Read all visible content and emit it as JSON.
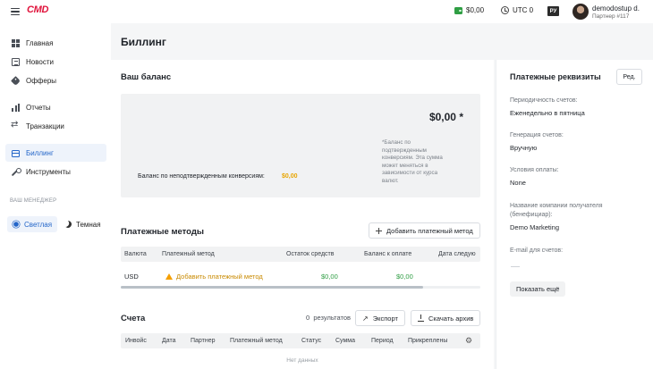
{
  "topbar": {
    "logo": "CMD",
    "balance": "$0,00",
    "timezone": "UTC 0",
    "language": "РУ",
    "user_name": "demodostup d.",
    "user_subtitle": "Партнер #117"
  },
  "sidebar": {
    "items": [
      {
        "label": "Главная",
        "icon": "dashboard-icon"
      },
      {
        "label": "Новости",
        "icon": "news-icon"
      },
      {
        "label": "Офферы",
        "icon": "tag-icon"
      },
      {
        "label": "Отчеты",
        "icon": "chart-icon"
      },
      {
        "label": "Транзакции",
        "icon": "transactions-icon"
      },
      {
        "label": "Биллинг",
        "icon": "credit-card-icon",
        "active": true
      },
      {
        "label": "Инструменты",
        "icon": "wrench-icon"
      }
    ],
    "manager_label": "ВАШ МЕНЕДЖЕР",
    "theme_light": "Светлая",
    "theme_dark": "Темная"
  },
  "page": {
    "title": "Биллинг"
  },
  "balance": {
    "heading": "Ваш баланс",
    "amount": "$0,00 *",
    "note": "*Баланс по подтвержденным конверсиям. Эта сумма может меняться в зависимости от курса валют.",
    "unconfirmed_label": "Баланс по неподтвержденным конверсиям:",
    "unconfirmed_value": "$0,00"
  },
  "payment_methods": {
    "heading": "Платежные методы",
    "add_button": "Добавить платежный метод",
    "columns": [
      "Валюта",
      "Платежный метод",
      "Остаток средств",
      "Баланс к оплате",
      "Дата следую"
    ],
    "rows": [
      {
        "currency": "USD",
        "method": "Добавить платежный метод",
        "remaining": "$0,00",
        "to_pay": "$0,00"
      }
    ]
  },
  "invoices": {
    "heading": "Счета",
    "results_count": "0",
    "results_label": "результатов",
    "export_button": "Экспорт",
    "download_button": "Скачать архив",
    "columns": [
      "Инвойс",
      "Дата",
      "Партнер",
      "Платежный метод",
      "Статус",
      "Сумма",
      "Период",
      "Прикреплены"
    ],
    "empty_text": "Нет данных"
  },
  "requisites": {
    "title": "Платежные реквизиты",
    "edit_button": "Ред.",
    "fields": [
      {
        "label": "Периодичность счетов:",
        "value": "Еженедельно в пятница"
      },
      {
        "label": "Генерация счетов:",
        "value": "Вручную"
      },
      {
        "label": "Условия оплаты:",
        "value": "None"
      },
      {
        "label": "Название компании получателя (бенефициар):",
        "value": "Demo Marketing"
      },
      {
        "label": "E-mail для счетов:",
        "value": ""
      }
    ],
    "show_more": "Показать ещё"
  },
  "colors": {
    "accent": "#2466c9",
    "positive": "#2f9e44",
    "warning": "#e8a500",
    "logo": "#e0143c"
  }
}
